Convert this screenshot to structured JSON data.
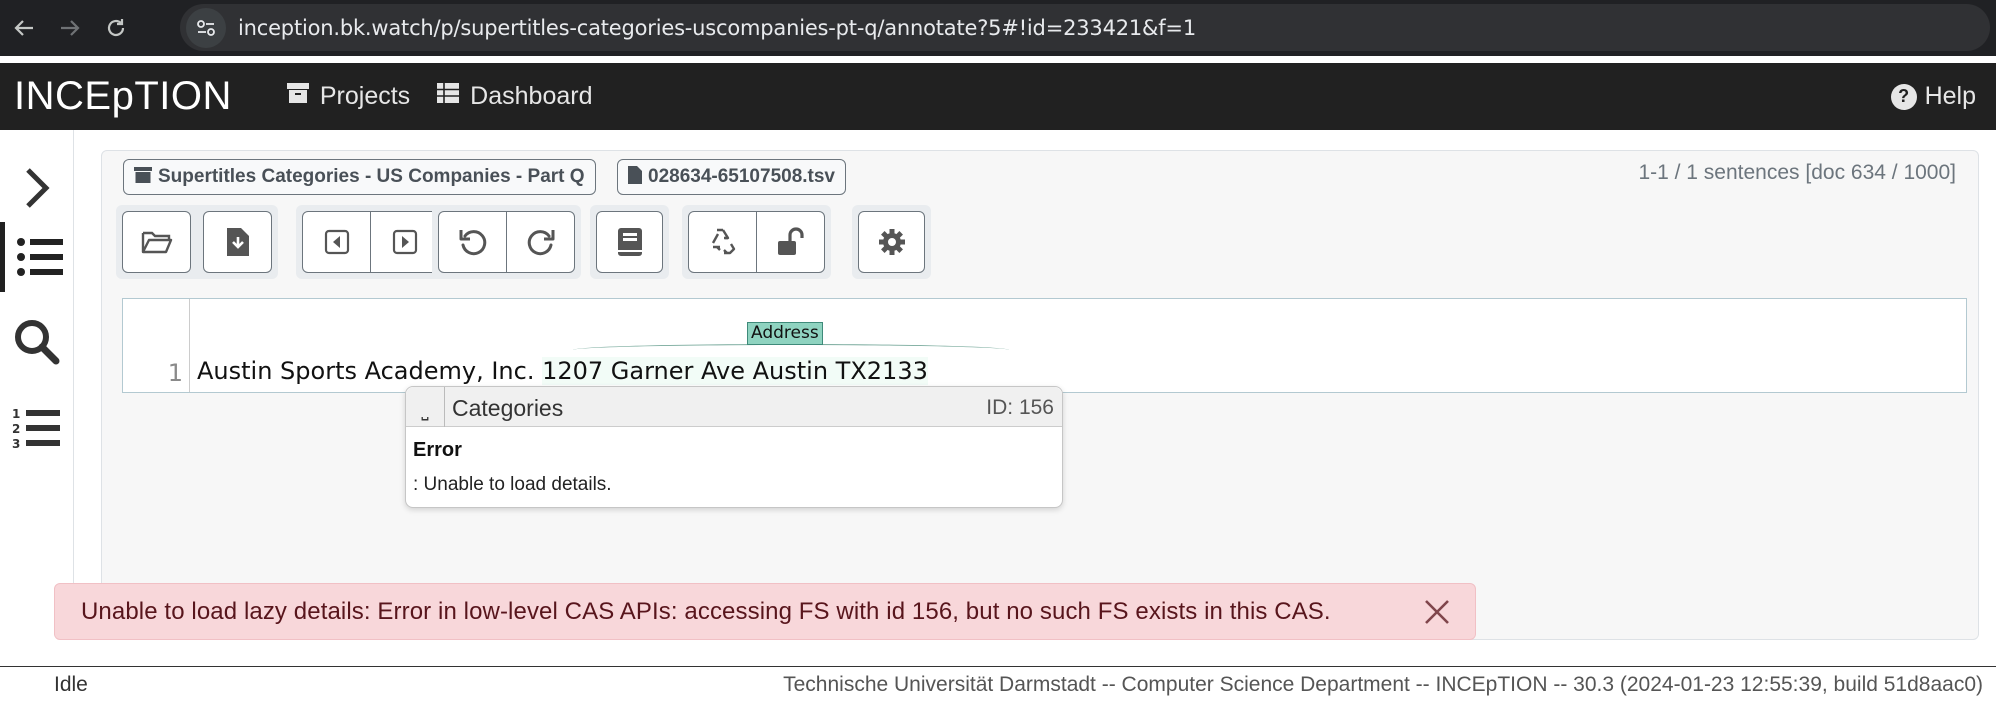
{
  "browser": {
    "url": "inception.bk.watch/p/supertitles-categories-uscompanies-pt-q/annotate?5#!id=233421&f=1",
    "back_icon": "arrow-left-icon",
    "forward_icon": "arrow-right-icon",
    "reload_icon": "reload-icon",
    "site_info_icon": "tune-icon"
  },
  "navbar": {
    "brand": "INCEpTION",
    "projects_label": "Projects",
    "dashboard_label": "Dashboard",
    "help_label": "Help"
  },
  "sidebar": {
    "items": [
      {
        "icon": "chevron-right-icon",
        "active": false
      },
      {
        "icon": "list-icon",
        "active": true
      },
      {
        "icon": "search-icon",
        "active": false
      },
      {
        "icon": "ordered-list-icon",
        "active": false
      }
    ]
  },
  "header": {
    "project_badge": "Supertitles Categories - US Companies - Part Q",
    "document_badge": "028634-65107508.tsv",
    "sentence_info": "1-1 / 1 sentences [doc 634 / 1000]"
  },
  "toolbar": {
    "groups": [
      [
        "open-folder-icon",
        "export-icon"
      ],
      [
        "prev-doc-icon",
        "next-doc-icon"
      ],
      [
        "undo-icon",
        "redo-icon"
      ],
      [
        "guidelines-icon"
      ],
      [
        "recycle-icon",
        "unlock-icon"
      ],
      [
        "settings-icon"
      ]
    ]
  },
  "editor": {
    "line_number": "1",
    "sentence_plain": "Austin Sports Academy, Inc. ",
    "sentence_annotated": "1207 Garner Ave Austin TX2133",
    "annotation_label": "Address",
    "annotation_color": "#8fd3c0"
  },
  "popover": {
    "pin_glyph": "⎵",
    "title": "Categories",
    "id_text": "ID: 156",
    "error_title": "Error",
    "error_message": ": Unable to load details."
  },
  "alert": {
    "message": "Unable to load lazy details: Error in low-level CAS APIs: accessing FS with id 156, but no such FS exists in this CAS.",
    "close_icon": "close-icon"
  },
  "footer": {
    "status": "Idle",
    "info": "Technische Universität Darmstadt -- Computer Science Department -- INCEpTION -- 30.3 (2024-01-23 12:55:39, build 51d8aac0)"
  }
}
